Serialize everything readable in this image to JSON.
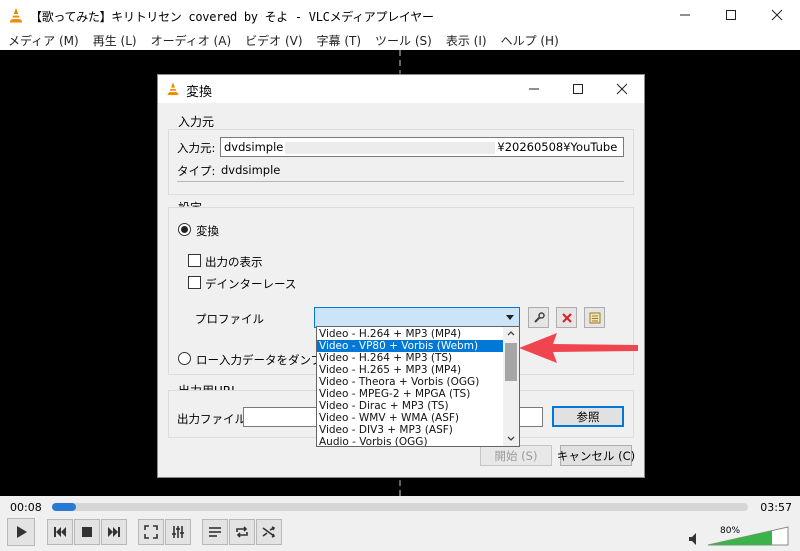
{
  "window": {
    "title": "【歌ってみた】キリトリセン covered by そよ - VLCメディアプレイヤー",
    "menu": [
      "メディア (M)",
      "再生 (L)",
      "オーディオ (A)",
      "ビデオ (V)",
      "字幕 (T)",
      "ツール (S)",
      "表示 (I)",
      "ヘルプ (H)"
    ]
  },
  "player": {
    "time_elapsed": "00:08",
    "time_total": "03:57",
    "progress": 0.034,
    "volume_label": "80%",
    "volume": 0.8
  },
  "dialog": {
    "title": "変換",
    "source_group_label": "入力元",
    "source_label": "入力元:",
    "source_value_start": "dvdsimple",
    "source_value_end": "¥20260508¥YouTube",
    "type_label": "タイプ:",
    "type_value": "dvdsimple",
    "settings_group_label": "設定",
    "convert_label": "変換",
    "show_output_label": "出力の表示",
    "deinterlace_label": "デインターレース",
    "profile_label": "プロファイル",
    "dump_label": "ロー入力データをダンプ",
    "profile_options": [
      "Video - H.264 + MP3 (MP4)",
      "Video - VP80 + Vorbis (Webm)",
      "Video - H.264 + MP3 (TS)",
      "Video - H.265 + MP3 (MP4)",
      "Video - Theora + Vorbis (OGG)",
      "Video - MPEG-2 + MPGA (TS)",
      "Video - Dirac + MP3 (TS)",
      "Video - WMV + WMA (ASF)",
      "Video - DIV3 + MP3 (ASF)",
      "Audio - Vorbis (OGG)"
    ],
    "selected_index": 1,
    "output_group_label": "出力用URL",
    "output_file_label": "出力ファイル:",
    "output_file_value": "",
    "browse_label": "参照",
    "start_label": "開始 (S)",
    "cancel_label": "キャンセル (C)"
  },
  "colors": {
    "accent": "#0078d7",
    "annotation_arrow": "#f0454f",
    "volume_fill": "#3bb34a",
    "seek_fill": "#2a7ad5"
  }
}
